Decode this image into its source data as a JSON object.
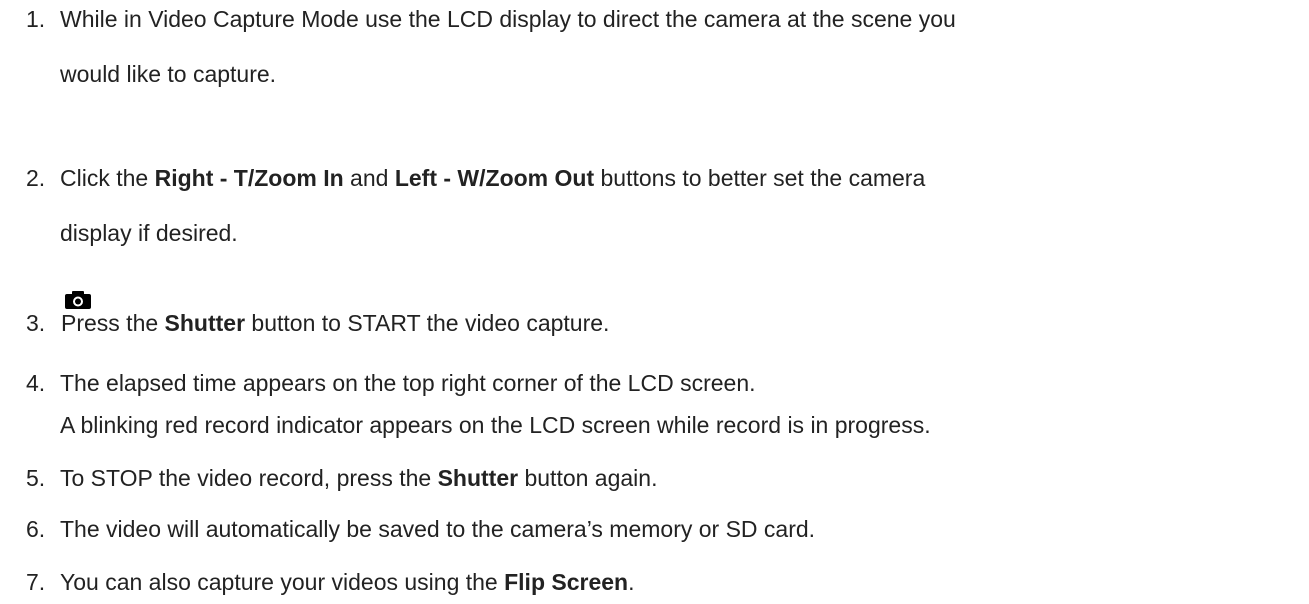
{
  "steps": [
    {
      "num": "1.",
      "line1": "While in Video Capture Mode use the LCD display to direct the camera at the scene you",
      "line2": "would like to capture."
    },
    {
      "num": "2.",
      "pre": "Click the ",
      "b1": "Right - T/Zoom In",
      "mid": " and ",
      "b2": "Left - W/Zoom Out",
      "post": " buttons to better set the camera",
      "line2": "display if desired."
    },
    {
      "num": "3.",
      "icon": "camera-icon",
      "pre": "Press the ",
      "b1": "Shutter",
      "post": " button to START the video capture."
    },
    {
      "num": "4.",
      "line1": "The elapsed time appears on the top right corner of the LCD screen.",
      "line2": "A blinking red record indicator appears on the LCD screen while record is in progress."
    },
    {
      "num": "5.",
      "pre": "To STOP the video record, press the ",
      "b1": "Shutter",
      "post": " button again."
    },
    {
      "num": "6.",
      "line1": "The video will automatically be saved to the camera’s memory or SD card."
    },
    {
      "num": "7.",
      "pre": "You can also capture your videos using the ",
      "b1": "Flip Screen",
      "post": "."
    }
  ]
}
